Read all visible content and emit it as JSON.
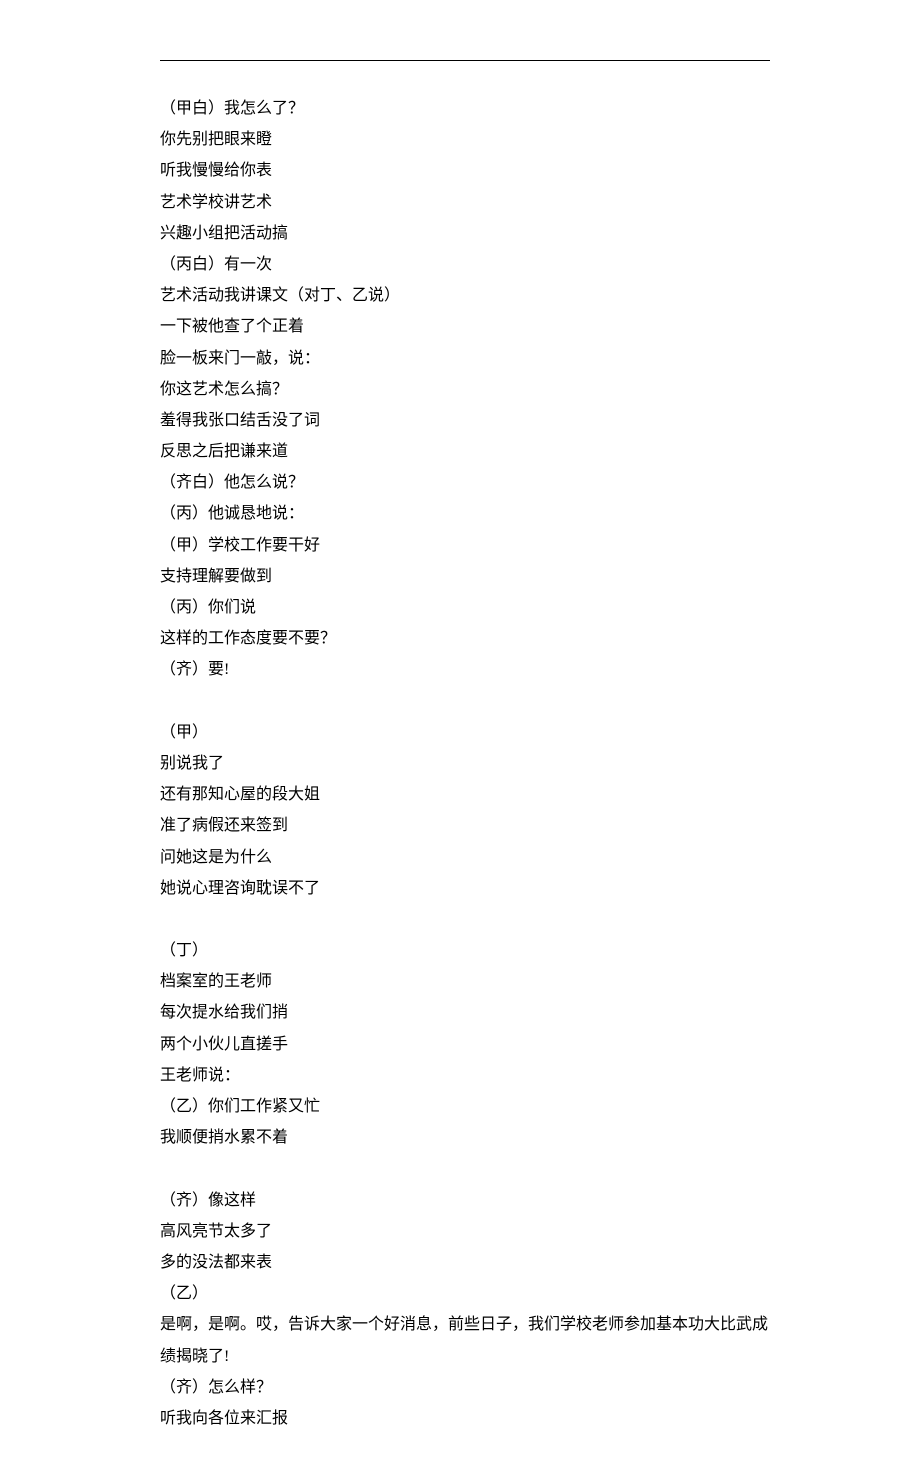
{
  "lines": [
    "（甲白）我怎么了？",
    "你先别把眼来瞪",
    "听我慢慢给你表",
    "艺术学校讲艺术",
    "兴趣小组把活动搞",
    "（丙白）有一次",
    "艺术活动我讲课文（对丁、乙说）",
    "一下被他查了个正着",
    "脸一板来门一敲，说：",
    "你这艺术怎么搞？",
    "羞得我张口结舌没了词",
    "反思之后把谦来道",
    "（齐白）他怎么说？",
    "（丙）他诚恳地说：",
    "（甲）学校工作要干好",
    "支持理解要做到",
    "（丙）你们说",
    "这样的工作态度要不要？",
    "（齐）要!",
    "",
    "（甲）",
    "别说我了",
    "还有那知心屋的段大姐",
    "准了病假还来签到",
    "问她这是为什么",
    "她说心理咨询耽误不了",
    "",
    "（丁）",
    "档案室的王老师",
    "每次提水给我们捎",
    "两个小伙儿直搓手",
    "王老师说：",
    "（乙）你们工作紧又忙",
    "我顺便捎水累不着",
    "",
    "（齐）像这样",
    "高风亮节太多了",
    "多的没法都来表",
    "（乙）",
    "是啊，是啊。哎，告诉大家一个好消息，前些日子，我们学校老师参加基本功大比武成绩揭晓了!",
    "（齐）怎么样？",
    "听我向各位来汇报"
  ]
}
